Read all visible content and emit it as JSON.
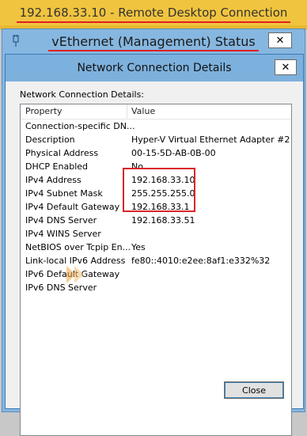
{
  "rdp": {
    "title": "192.168.33.10 - Remote Desktop Connection"
  },
  "status_window": {
    "title": "vEthernet (Management) Status",
    "close": "✕"
  },
  "details_window": {
    "title": "Network Connection Details",
    "close": "✕",
    "section_label": "Network Connection Details:",
    "columns": {
      "property": "Property",
      "value": "Value"
    },
    "rows": [
      {
        "property": "Connection-specific DN...",
        "value": ""
      },
      {
        "property": "Description",
        "value": "Hyper-V Virtual Ethernet Adapter #2"
      },
      {
        "property": "Physical Address",
        "value": "00-15-5D-AB-0B-00"
      },
      {
        "property": "DHCP Enabled",
        "value": "No"
      },
      {
        "property": "IPv4 Address",
        "value": "192.168.33.10"
      },
      {
        "property": "IPv4 Subnet Mask",
        "value": "255.255.255.0"
      },
      {
        "property": "IPv4 Default Gateway",
        "value": "192.168.33.1"
      },
      {
        "property": "IPv4 DNS Server",
        "value": "192.168.33.51"
      },
      {
        "property": "IPv4 WINS Server",
        "value": ""
      },
      {
        "property": "NetBIOS over Tcpip En...",
        "value": "Yes"
      },
      {
        "property": "Link-local IPv6 Address",
        "value": "fe80::4010:e2ee:8af1:e332%32"
      },
      {
        "property": "IPv6 Default Gateway",
        "value": ""
      },
      {
        "property": "IPv6 DNS Server",
        "value": ""
      }
    ],
    "close_button": "Close"
  },
  "colors": {
    "rdp_bar": "#f1c43f",
    "highlight": "#d9262a",
    "title_bar": "#7db1dd"
  }
}
